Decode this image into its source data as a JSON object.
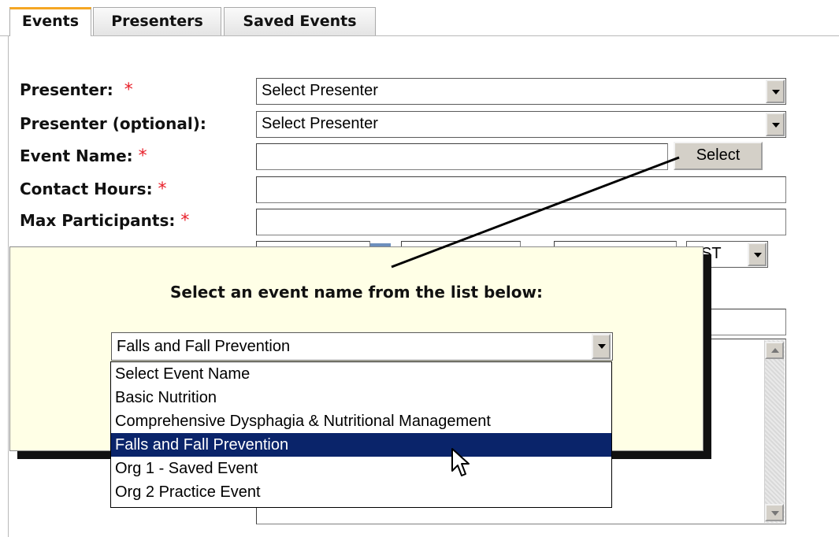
{
  "tabs": [
    {
      "label": "Events",
      "active": true
    },
    {
      "label": "Presenters",
      "active": false
    },
    {
      "label": "Saved Events",
      "active": false
    }
  ],
  "form": {
    "required_mark": "*",
    "presenter_label": "Presenter:",
    "presenter_value": "Select Presenter",
    "presenter_optional_label": "Presenter (optional):",
    "presenter_optional_value": "Select Presenter",
    "event_name_label": "Event Name:",
    "event_name_value": "",
    "select_button": "Select",
    "contact_hours_label": "Contact Hours:",
    "contact_hours_value": "",
    "max_participants_label": "Max Participants:",
    "max_participants_value": "",
    "timezone_partial": "ST"
  },
  "popup": {
    "title": "Select an event name from the list below:",
    "selected_value": "Falls and Fall Prevention",
    "options": [
      "Select Event Name",
      "Basic Nutrition",
      "Comprehensive Dysphagia & Nutritional Management",
      "Falls and Fall Prevention",
      "Org 1 - Saved Event",
      "Org 2 Practice Event"
    ],
    "highlighted_index": 3
  },
  "colors": {
    "required": "#e8202a",
    "popup_bg": "#ffffe6",
    "highlight": "#0a246a",
    "active_tab_accent": "#f5a623"
  }
}
